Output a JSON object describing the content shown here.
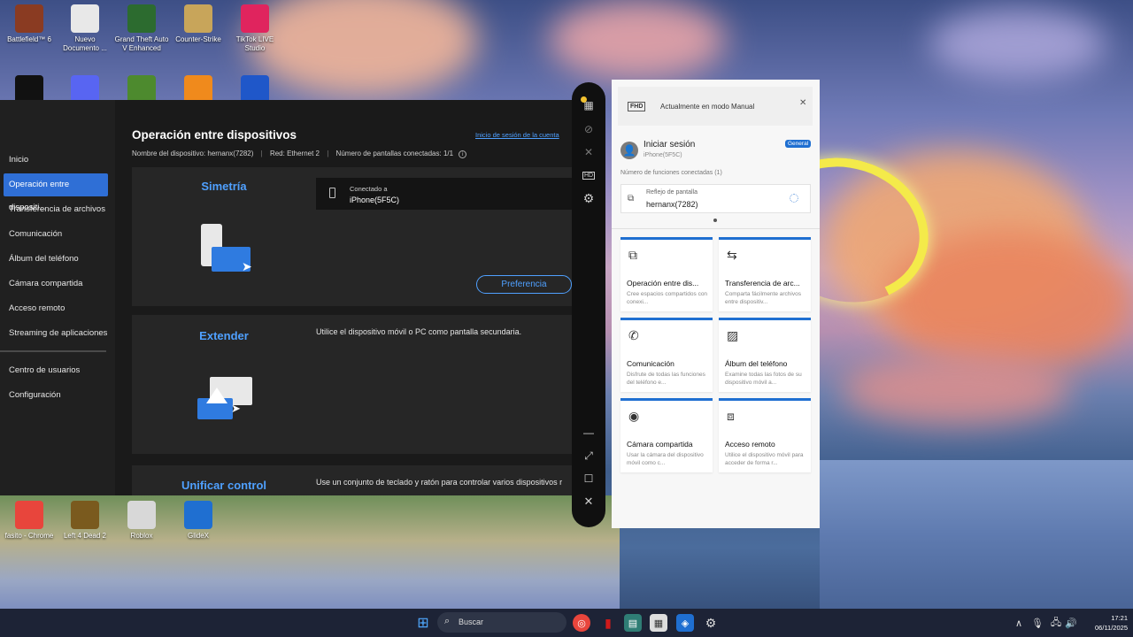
{
  "desktop": {
    "icons_top": [
      {
        "label": "Battlefield™ 6",
        "icon": "battlefield-icon",
        "color": "#8a3b22"
      },
      {
        "label": "Nuevo Documento ...",
        "icon": "document-icon",
        "color": "#e8e8e8"
      },
      {
        "label": "Grand Theft Auto V Enhanced",
        "icon": "gta-icon",
        "color": "#2c6b2f"
      },
      {
        "label": "Counter-Strike",
        "icon": "counter-strike-icon",
        "color": "#c8a55a"
      },
      {
        "label": "TikTok LIVE Studio",
        "icon": "tiktok-icon",
        "color": "#e0245e"
      }
    ],
    "icons_row2": [
      {
        "label": "",
        "icon": "obs-icon",
        "color": "#111111"
      },
      {
        "label": "",
        "icon": "discord-icon",
        "color": "#5865f2"
      },
      {
        "label": "",
        "icon": "minecraft-icon",
        "color": "#4d8a2e"
      },
      {
        "label": "",
        "icon": "half-life-icon",
        "color": "#f08a1c"
      },
      {
        "label": "",
        "icon": "capture-icon",
        "color": "#1f57c9"
      }
    ],
    "icons_bottom": [
      {
        "label": "fasito - Chrome",
        "icon": "chrome-icon",
        "color": "#e8453c"
      },
      {
        "label": "Left 4 Dead 2",
        "icon": "left4dead-icon",
        "color": "#7a5a1e"
      },
      {
        "label": "Roblox",
        "icon": "roblox-icon",
        "color": "#d8d8d8"
      },
      {
        "label": "GlideX",
        "icon": "glidex-icon",
        "color": "#1f6fd1"
      }
    ]
  },
  "app": {
    "title": "Operación entre dispositivos",
    "account_link": "Inicio de sesión de la cuenta",
    "device_name": "Nombre del dispositivo: hernanx(7282)",
    "network": "Red: Ethernet 2",
    "screens": "Número de pantallas conectadas: 1/1",
    "nav": [
      "Inicio",
      "Operación entre dispositi...",
      "Transferencia de archivos",
      "Comunicación",
      "Álbum del teléfono",
      "Cámara compartida",
      "Acceso remoto",
      "Streaming de aplicaciones",
      "Centro de usuarios",
      "Configuración"
    ],
    "active_nav": 1,
    "mirror": {
      "title": "Simetría",
      "connected_label": "Conectado a",
      "connected_device": "iPhone(5F5C)",
      "pref_button": "Preferencia"
    },
    "extend": {
      "title": "Extender",
      "desc": "Utilice el dispositivo móvil o PC como pantalla secundaria."
    },
    "unify": {
      "title": "Unificar control",
      "desc": "Use un conjunto de teclado y ratón para controlar varios dispositivos r"
    },
    "accent": "#2f6fd6"
  },
  "panel": {
    "mode_badge": "FHD",
    "mode_text": "Actualmente en modo Manual",
    "signin": "Iniciar sesión",
    "device": "iPhone(5F5C)",
    "general_badge": "General",
    "func_count": "Número de funciones conectadas (1)",
    "mirror_label": "Reflejo de pantalla",
    "mirror_device": "hernanx(7282)",
    "tiles": [
      {
        "title": "Operación entre dis...",
        "desc": "Cree espacios compartidos con conexi...",
        "icon": "devices-icon",
        "glyph": "⧉"
      },
      {
        "title": "Transferencia de arc...",
        "desc": "Comparta fácilmente archivos entre dispositiv...",
        "icon": "transfer-icon",
        "glyph": "⇆"
      },
      {
        "title": "Comunicación",
        "desc": "Disfrute de todas las funciones del teléfono e...",
        "icon": "phone-icon",
        "glyph": "✆"
      },
      {
        "title": "Álbum del teléfono",
        "desc": "Examine todas las fotos de su dispositivo móvil a...",
        "icon": "album-icon",
        "glyph": "▨"
      },
      {
        "title": "Cámara compartida",
        "desc": "Usar la cámara del dispositivo móvil como c...",
        "icon": "camera-icon",
        "glyph": "◉"
      },
      {
        "title": "Acceso remoto",
        "desc": "Utilice el dispositivo móvil para acceder de forma r...",
        "icon": "remote-icon",
        "glyph": "⧈"
      }
    ]
  },
  "taskbar": {
    "search_placeholder": "Buscar",
    "time": "17:21",
    "date": "06/11/2025",
    "color": "#1d2336"
  }
}
